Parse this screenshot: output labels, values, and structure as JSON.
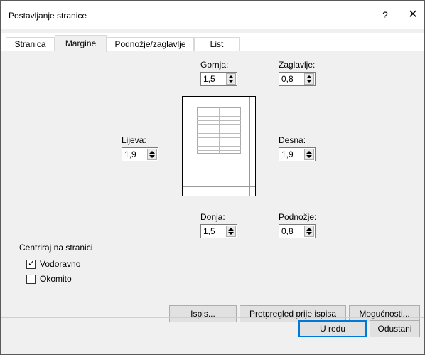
{
  "dialog": {
    "title": "Postavljanje stranice",
    "help": "?",
    "close": "✕"
  },
  "tabs": [
    {
      "label": "Stranica",
      "active": false
    },
    {
      "label": "Margine",
      "active": true
    },
    {
      "label": "Podnožje/zaglavlje",
      "active": false
    },
    {
      "label": "List",
      "active": false
    }
  ],
  "margins": {
    "top": {
      "label": "Gornja:",
      "value": "1,5"
    },
    "header": {
      "label": "Zaglavlje:",
      "value": "0,8"
    },
    "left": {
      "label": "Lijeva:",
      "value": "1,9"
    },
    "right": {
      "label": "Desna:",
      "value": "1,9"
    },
    "bottom": {
      "label": "Donja:",
      "value": "1,5"
    },
    "footer": {
      "label": "Podnožje:",
      "value": "0,8"
    }
  },
  "center": {
    "group_label": "Centriraj na stranici",
    "horizontal": {
      "label": "Vodoravno",
      "checked": true
    },
    "vertical": {
      "label": "Okomito",
      "checked": false
    }
  },
  "buttons": {
    "print": "Ispis...",
    "print_preview": "Pretpregled prije ispisa",
    "options": "Mogućnosti...",
    "ok": "U redu",
    "cancel": "Odustani"
  }
}
